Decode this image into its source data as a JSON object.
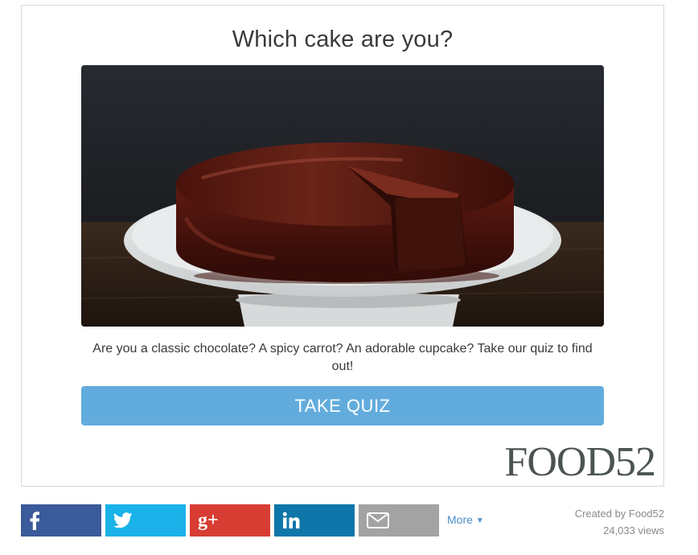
{
  "quiz": {
    "title": "Which cake are you?",
    "image_alt": "chocolate cake on a white cake stand",
    "description": "Are you a classic chocolate? A spicy carrot? An adorable cupcake? Take our quiz to find out!",
    "cta_label": "TAKE QUIZ",
    "brand": "FOOD52"
  },
  "share": {
    "buttons": [
      {
        "network": "facebook",
        "icon": "facebook-icon",
        "color": "#3b5a9a"
      },
      {
        "network": "twitter",
        "icon": "twitter-icon",
        "color": "#1ab2e8"
      },
      {
        "network": "google-plus",
        "icon": "google-plus-icon",
        "color": "#d73d32",
        "glyph": "g+"
      },
      {
        "network": "linkedin",
        "icon": "linkedin-icon",
        "color": "#0e76a8"
      },
      {
        "network": "email",
        "icon": "envelope-icon",
        "color": "#a3a3a3"
      }
    ],
    "more_label": "More",
    "more_icon": "caret-down-icon"
  },
  "meta": {
    "created_by": "Created by Food52",
    "views": "24,033 views"
  },
  "colors": {
    "cta": "#62acdd",
    "link": "#4b8ec9",
    "brand": "#4c5453"
  }
}
